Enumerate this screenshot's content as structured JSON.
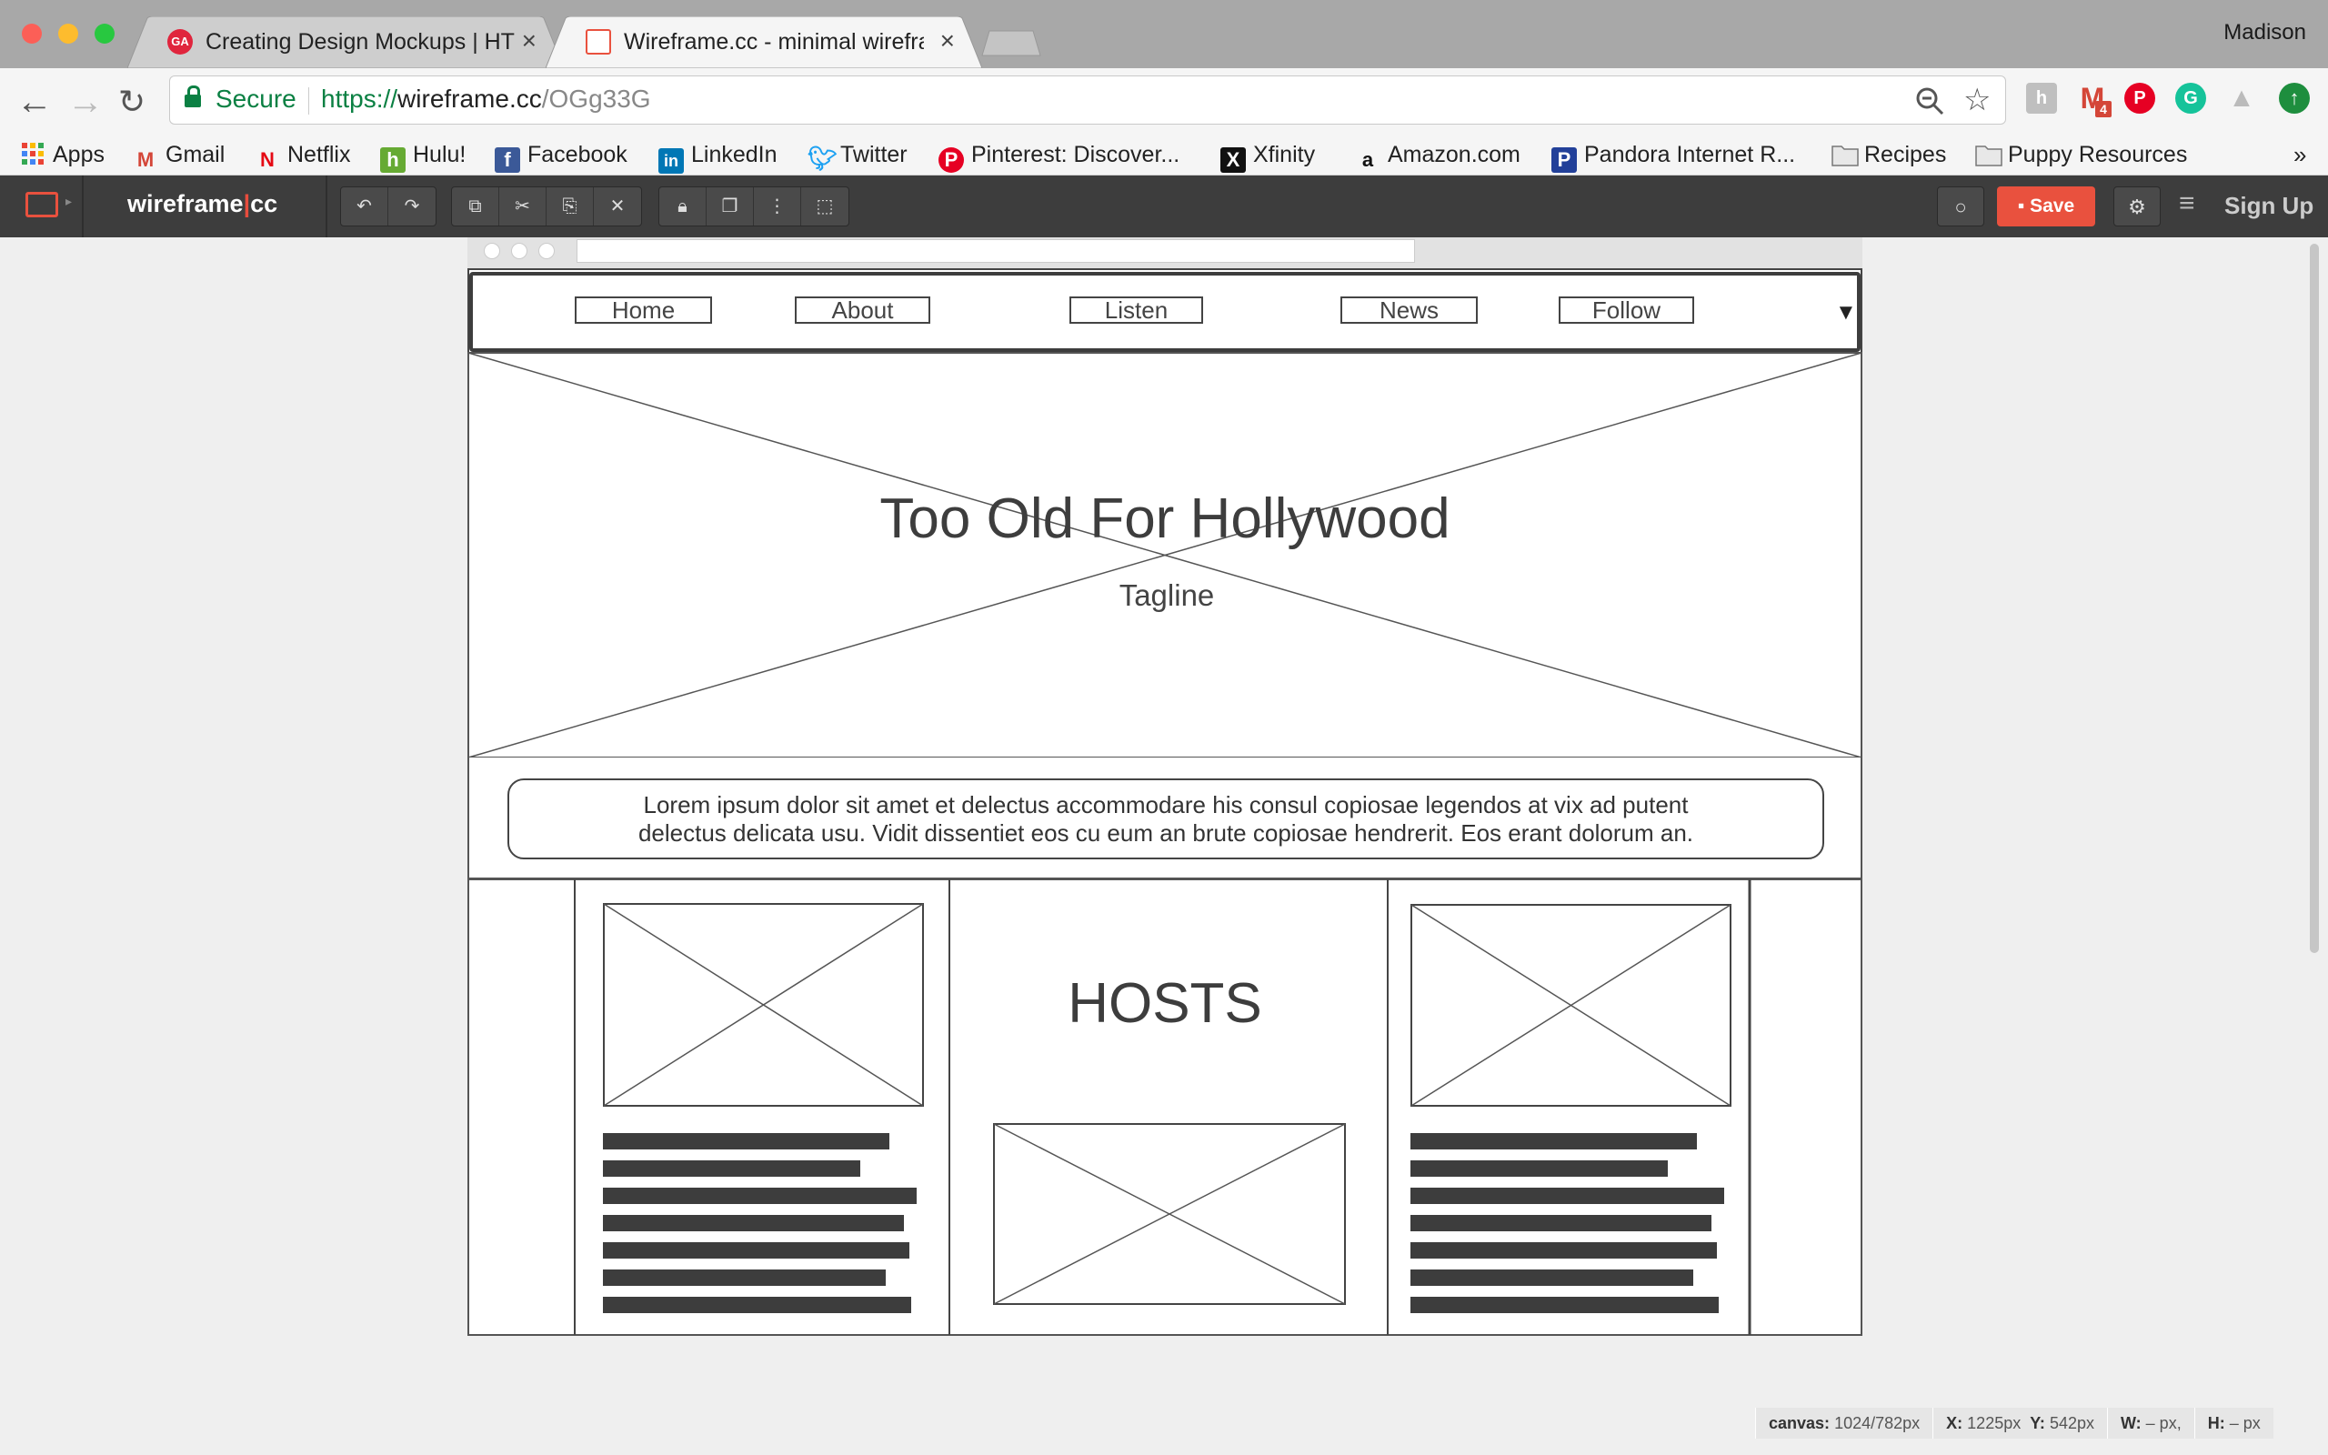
{
  "browser": {
    "tabs": [
      {
        "title": "Creating Design Mockups | HT",
        "favicon": "ga-icon",
        "active": false
      },
      {
        "title": "Wireframe.cc - minimal wirefra",
        "favicon": "wireframe-favicon",
        "active": true
      }
    ],
    "profile": "Madison",
    "secure_label": "Secure",
    "url": {
      "scheme": "https://",
      "host": "wireframe.cc",
      "path": "/OGg33G"
    },
    "bookmarks": [
      {
        "label": "Apps",
        "icon": "apps-grid-icon"
      },
      {
        "label": "Gmail",
        "icon": "gmail-icon"
      },
      {
        "label": "Netflix",
        "icon": "netflix-icon"
      },
      {
        "label": "Hulu!",
        "icon": "hulu-icon"
      },
      {
        "label": "Facebook",
        "icon": "facebook-icon"
      },
      {
        "label": "LinkedIn",
        "icon": "linkedin-icon"
      },
      {
        "label": "Twitter",
        "icon": "twitter-icon"
      },
      {
        "label": "Pinterest: Discover...",
        "icon": "pinterest-icon"
      },
      {
        "label": "Xfinity",
        "icon": "xfinity-icon"
      },
      {
        "label": "Amazon.com",
        "icon": "amazon-icon"
      },
      {
        "label": "Pandora Internet R...",
        "icon": "pandora-icon"
      },
      {
        "label": "Recipes",
        "icon": "folder-icon"
      },
      {
        "label": "Puppy Resources",
        "icon": "folder-icon"
      }
    ],
    "overflow": "»",
    "gmail_badge": "4"
  },
  "app": {
    "logo_left": "wireframe",
    "logo_sep": "|",
    "logo_right": "cc",
    "save_label": "Save",
    "signup_label": "Sign Up"
  },
  "wireframe": {
    "nav": [
      "Home",
      "About",
      "Listen",
      "News",
      "Follow"
    ],
    "nav_dropdown": "▼",
    "hero_title": "Too Old For Hollywood",
    "hero_tagline": "Tagline",
    "intro_text_1": "Lorem ipsum dolor sit amet et delectus accommodare his consul copiosae legendos at vix ad putent",
    "intro_text_2": "delectus delicata usu. Vidit dissentiet eos cu eum an brute copiosae hendrerit. Eos erant dolorum an.",
    "hosts_title": "HOSTS"
  },
  "status": {
    "canvas_label": "canvas:",
    "canvas_value": "1024/782px",
    "x_label": "X:",
    "x_value": "1225px",
    "y_label": "Y:",
    "y_value": "542px",
    "w_label": "W:",
    "w_value": "– px,",
    "h_label": "H:",
    "h_value": "– px"
  },
  "colors": {
    "save": "#e9513e",
    "secure": "#0b8043",
    "appbar": "#3d3d3d"
  }
}
